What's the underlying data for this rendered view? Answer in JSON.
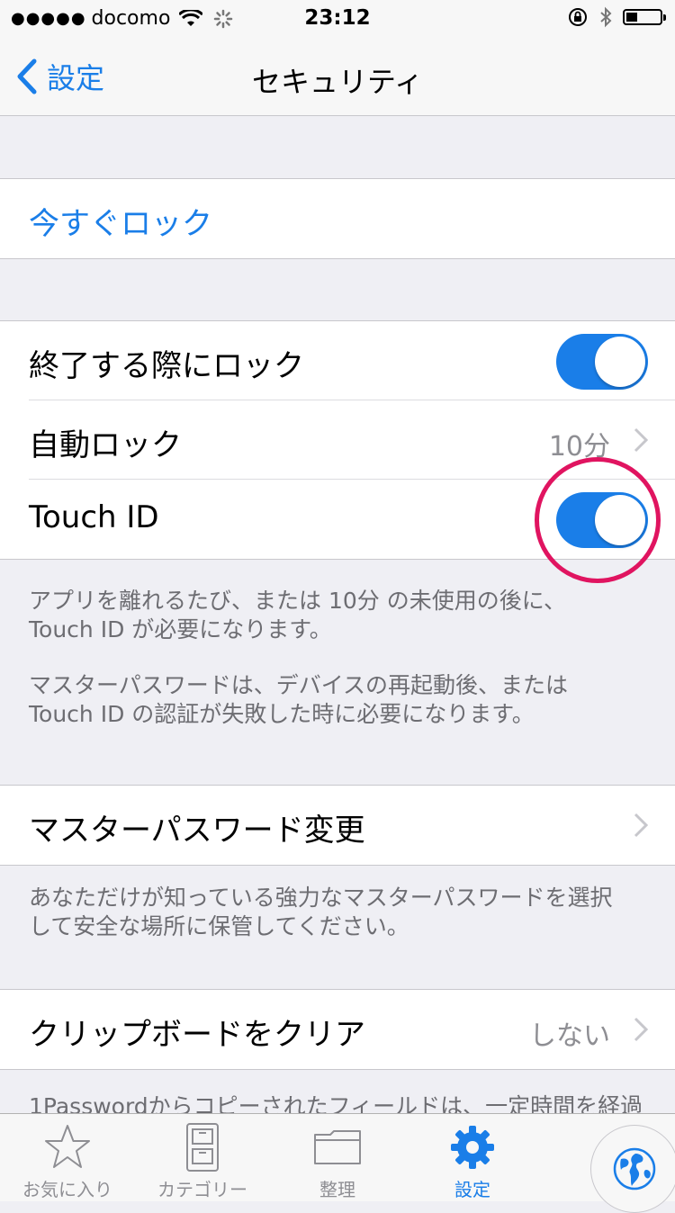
{
  "status": {
    "carrier": "docomo",
    "time": "23:12",
    "signal": "●●●●●"
  },
  "nav": {
    "back_label": "設定",
    "title": "セキュリティ"
  },
  "lock_now": {
    "label": "今すぐロック"
  },
  "settings": {
    "lock_on_exit": {
      "label": "終了する際にロック",
      "enabled": true
    },
    "auto_lock": {
      "label": "自動ロック",
      "value": "10分"
    },
    "touch_id": {
      "label": "Touch ID",
      "enabled": true
    }
  },
  "touch_id_footer": {
    "line1": "アプリを離れるたび、または 10分 の未使用の後に、",
    "line2": "Touch ID が必要になります。",
    "line3": "マスターパスワードは、デバイスの再起動後、または",
    "line4": "Touch ID の認証が失敗した時に必要になります。"
  },
  "master_password": {
    "label": "マスターパスワード変更",
    "footer1": "あなただけが知っている強力なマスターパスワードを選択",
    "footer2": "して安全な場所に保管してください。"
  },
  "clipboard": {
    "label": "クリップボードをクリア",
    "value": "しない",
    "footer_partial": "1Passwordからコピーされたフィールドは、一定時間を経過"
  },
  "tabs": [
    {
      "label": "お気に入り",
      "icon": "star-icon"
    },
    {
      "label": "カテゴリー",
      "icon": "cabinet-icon"
    },
    {
      "label": "整理",
      "icon": "folder-icon"
    },
    {
      "label": "設定",
      "icon": "gear-icon",
      "active": true
    }
  ],
  "colors": {
    "accent": "#1a7ee8",
    "highlight": "#e01460"
  }
}
